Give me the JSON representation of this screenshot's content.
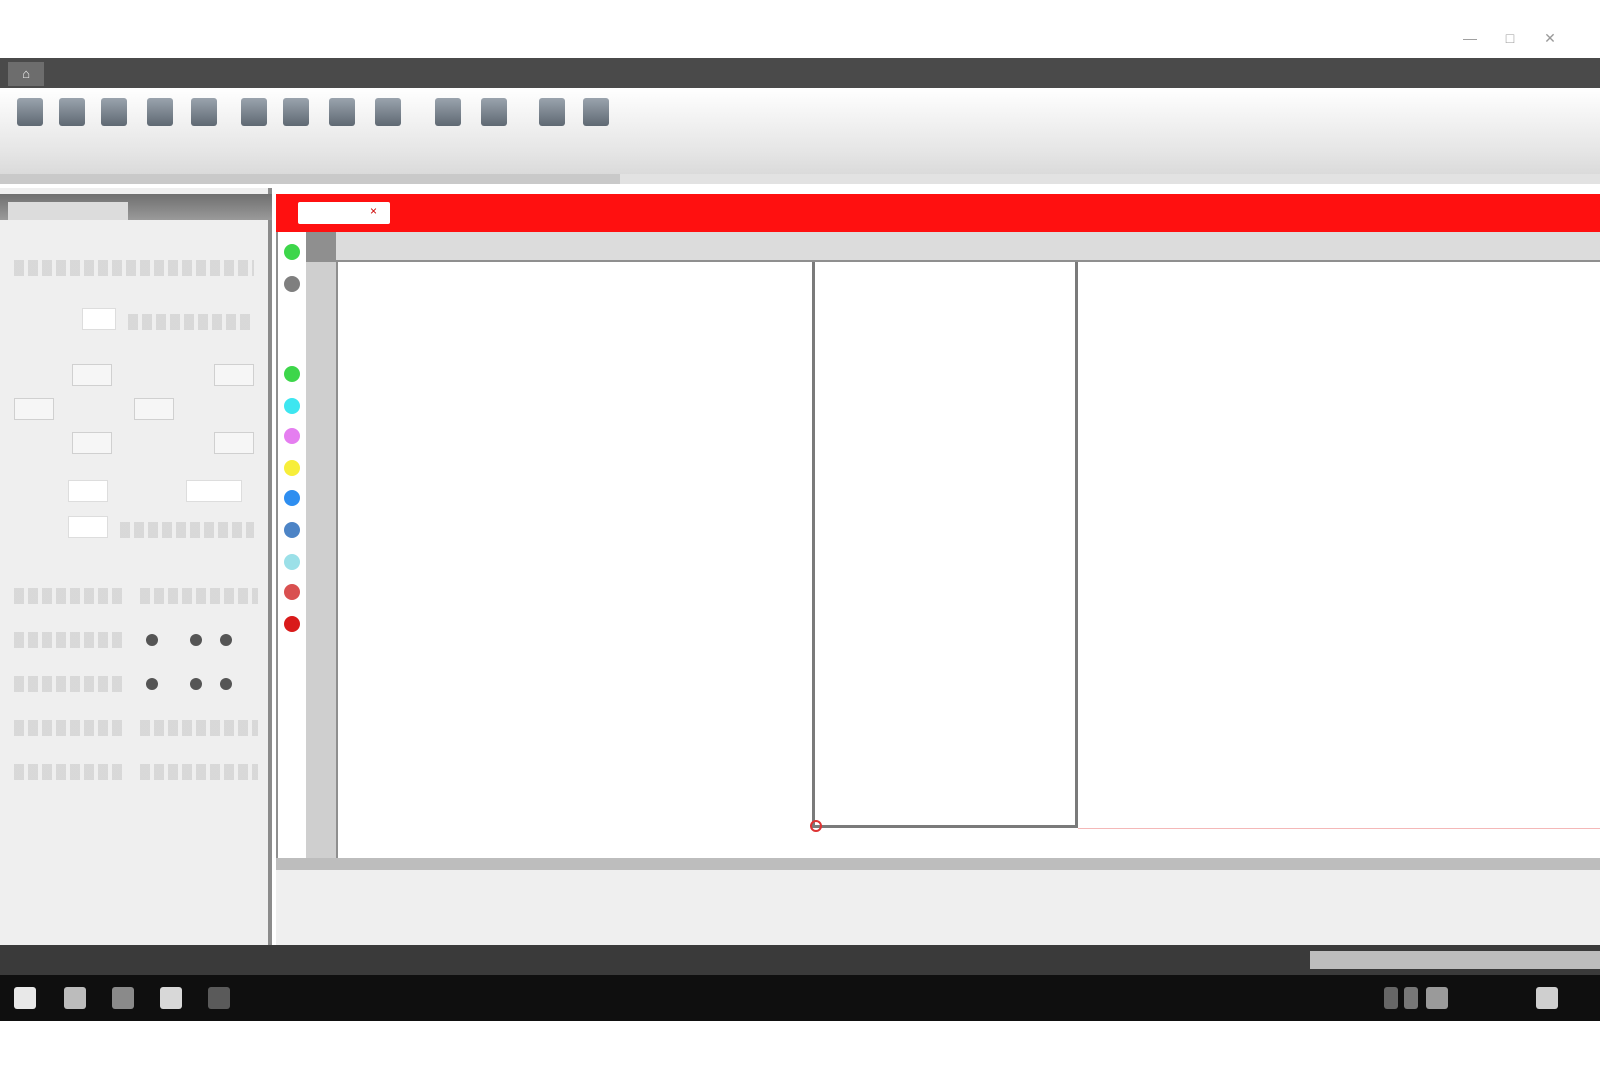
{
  "window": {
    "title": "",
    "user": ""
  },
  "tabs": [
    "",
    "",
    ""
  ],
  "toolbar": {
    "tools": [
      {
        "name": "tool-1-icon",
        "label": ""
      },
      {
        "name": "tool-2-icon",
        "label": ""
      },
      {
        "name": "tool-3-icon",
        "label": ""
      },
      {
        "name": "tool-4-icon",
        "label": ""
      },
      {
        "name": "tool-5-icon",
        "label": ""
      },
      {
        "name": "tool-6-icon",
        "label": ""
      },
      {
        "name": "tool-7-icon",
        "label": ""
      },
      {
        "name": "tool-8-icon",
        "label": ""
      },
      {
        "name": "tool-9-icon",
        "label": ""
      },
      {
        "name": "tool-10-icon",
        "label": ""
      },
      {
        "name": "tool-11-icon",
        "label": ""
      },
      {
        "name": "tool-12-icon",
        "label": ""
      },
      {
        "name": "tool-13-icon",
        "label": ""
      }
    ]
  },
  "left_panel": {
    "header_tab": "",
    "pos_label": "",
    "dir_buttons": [
      "",
      "",
      "",
      "",
      "",
      ""
    ],
    "x_label": "",
    "y_label": "",
    "speed_label": "",
    "rows": [
      "",
      "",
      "",
      "",
      ""
    ]
  },
  "editor": {
    "file_tab": "",
    "header_texts": [
      "",
      ""
    ],
    "ruler_ticks": [
      "",
      "",
      "",
      "",
      "",
      "",
      "",
      "",
      "",
      "",
      "",
      ""
    ],
    "layer_colors": [
      "#3dd64a",
      "#7f7f7f",
      "#ffffff",
      "#3dd64a",
      "#3ee6f0",
      "#e57ef0",
      "#f7ee3a",
      "#2e8ef0",
      "#4d84c6",
      "#9be0e8",
      "#d95050",
      "#d91a1a",
      "#ffffff"
    ]
  },
  "output": {
    "line": ""
  },
  "status": [
    "",
    "",
    "",
    "",
    "",
    "",
    ""
  ],
  "taskbar": {
    "time": "",
    "date": ""
  },
  "colors": {
    "accent": "#ff1010",
    "statusbar": "#3a3a3a",
    "taskbar": "#0f0f0f"
  }
}
